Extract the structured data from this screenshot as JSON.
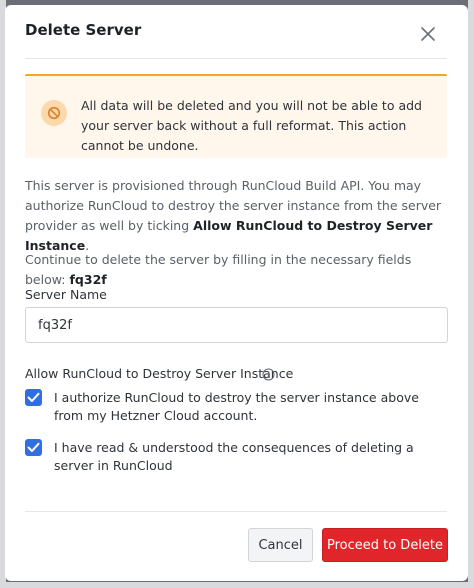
{
  "modal": {
    "title": "Delete Server"
  },
  "alert": {
    "message": "All data will be deleted and you will not be able to add your server back without a full reformat. This action cannot be undone."
  },
  "description": {
    "text": "This server is provisioned through RunCloud Build API. You may authorize RunCloud to destroy the server instance from the server provider as well by ticking ",
    "bold": "Allow RunCloud to Destroy Server Instance",
    "suffix": "."
  },
  "continue": {
    "text": "Continue to delete the server by filling in the necessary fields below: ",
    "server_code": "fq32f"
  },
  "server_name": {
    "label": "Server Name",
    "value": "fq32f"
  },
  "destroy": {
    "label": "Allow RunCloud to Destroy Server Instance"
  },
  "checkboxes": [
    {
      "label": "I authorize RunCloud to destroy the server instance above from my Hetzner Cloud account.",
      "checked": true
    },
    {
      "label": "I have read & understood the consequences of deleting a server in RunCloud",
      "checked": true
    }
  ],
  "footer": {
    "cancel_label": "Cancel",
    "delete_label": "Proceed to Delete"
  },
  "colors": {
    "accent_blue": "#2f6fe0",
    "danger_red": "#e0262b",
    "warning_orange": "#f5a623",
    "warning_bg": "#fff6ec"
  },
  "icons": {
    "close": "close-icon",
    "alert": "ban-icon",
    "info": "info-icon",
    "check": "check-icon"
  }
}
